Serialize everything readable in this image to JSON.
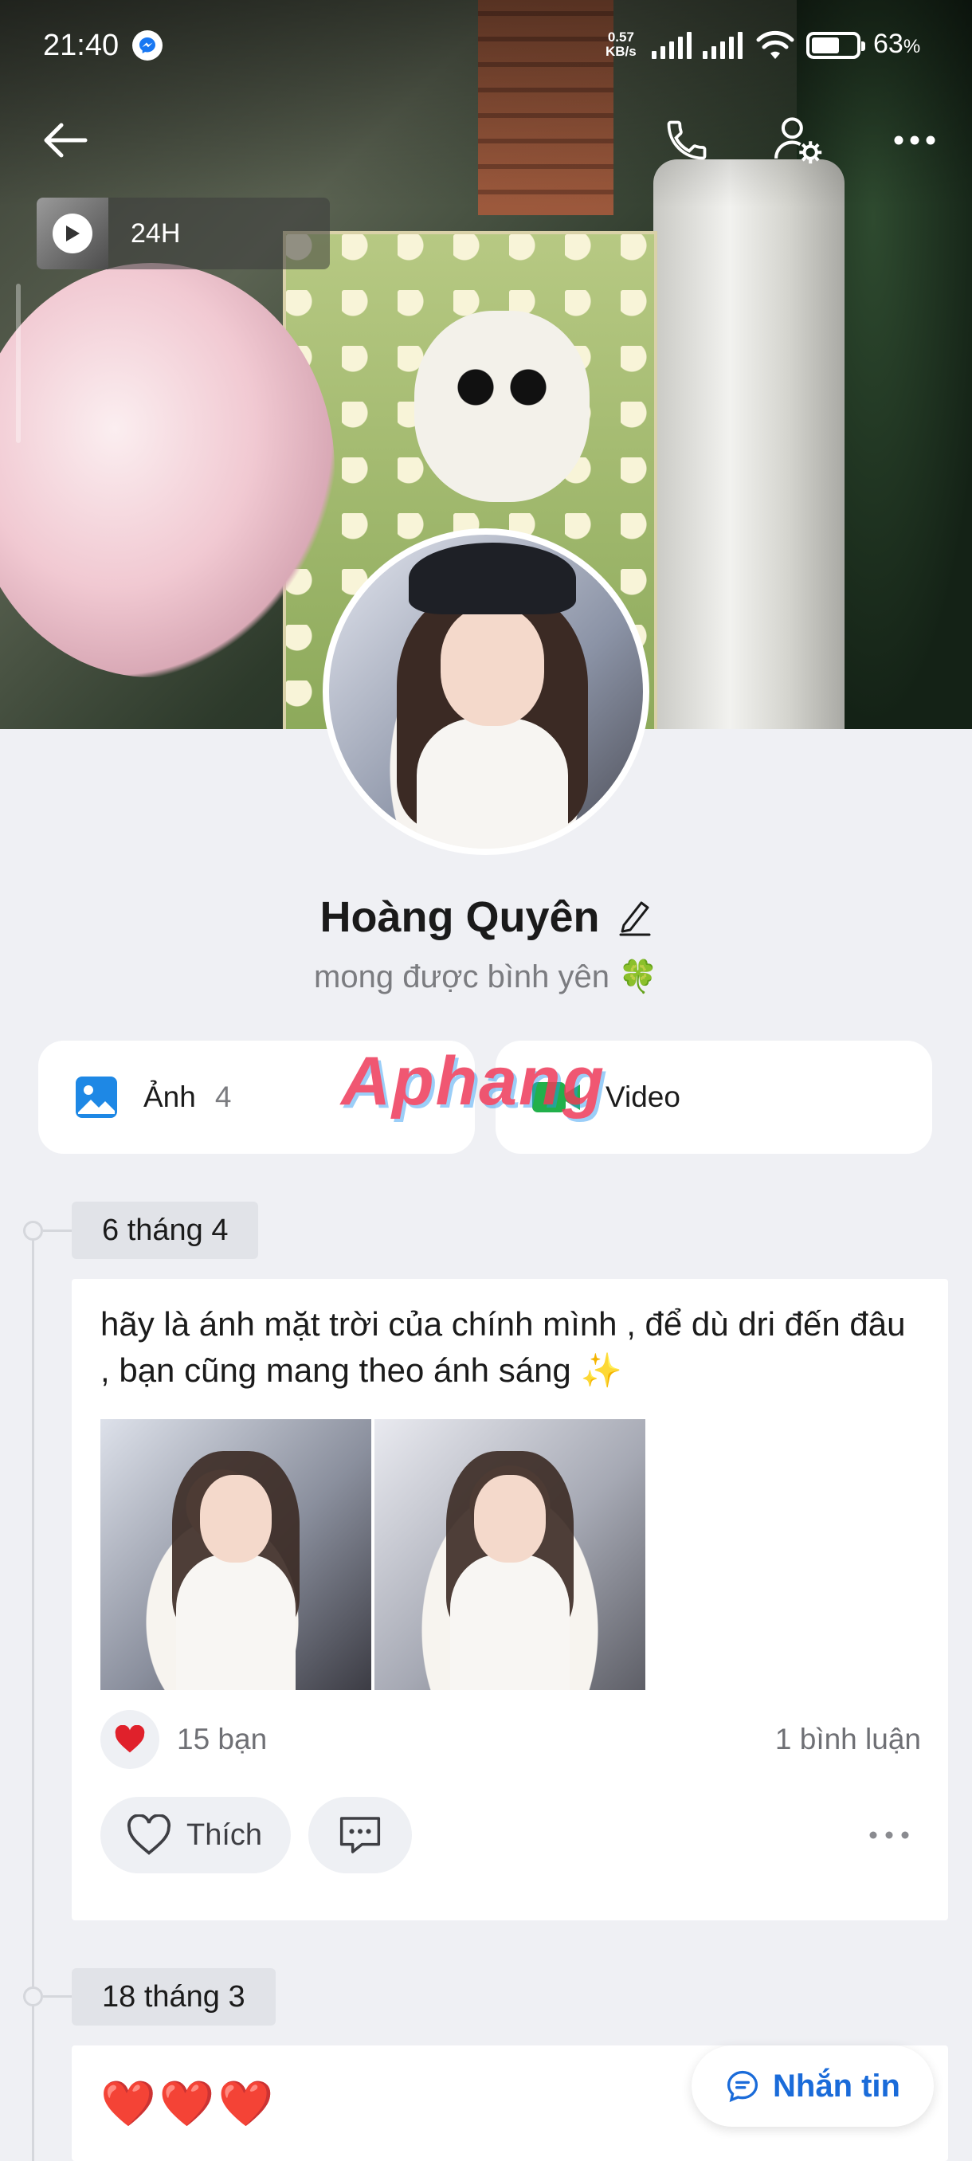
{
  "status_bar": {
    "time": "21:40",
    "speed_value": "0.57",
    "speed_unit": "KB/s",
    "battery_percent_label": "63",
    "battery_percent_sign": "%",
    "battery_level": 0.63
  },
  "cover": {
    "story_label": "24H"
  },
  "profile": {
    "name": "Hoàng Quyên",
    "bio": "mong được bình yên 🍀"
  },
  "media": {
    "photos_label": "Ảnh",
    "photos_count": "4",
    "video_label": "Video",
    "watermark": "Aphang"
  },
  "posts": [
    {
      "date": "6 tháng 4",
      "text": "hãy là ánh mặt trời của chính mình , để dù dri đến đâu , bạn cũng mang theo ánh sáng ✨",
      "reactions_label": "15 bạn",
      "comments_label": "1 bình luận",
      "like_label": "Thích"
    },
    {
      "date": "18 tháng 3",
      "text": "❤️❤️❤️"
    }
  ],
  "fab": {
    "label": "Nhắn tin"
  },
  "colors": {
    "background": "#eff0f4",
    "accent": "#1a6bd9",
    "heart": "#e0212b",
    "video_green": "#22b04b",
    "photo_blue": "#1e88e5"
  }
}
